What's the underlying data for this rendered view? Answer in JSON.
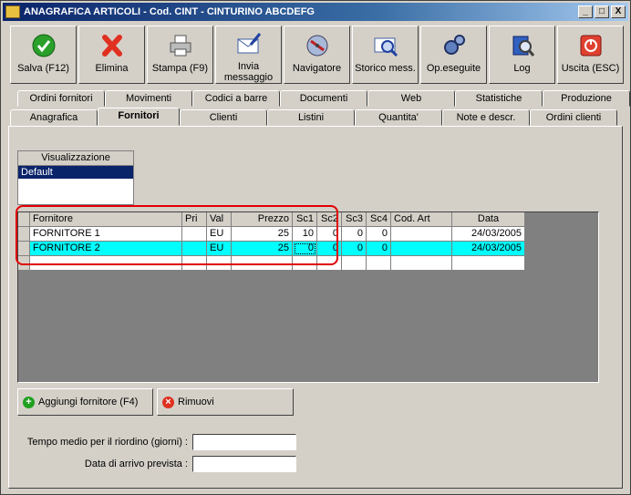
{
  "window": {
    "title": "ANAGRAFICA ARTICOLI - Cod. CINT - CINTURINO ABCDEFG",
    "min": "_",
    "max": "□",
    "close": "X"
  },
  "toolbar": [
    {
      "label": "Salva (F12)",
      "icon": "check-icon"
    },
    {
      "label": "Elimina",
      "icon": "delete-x-icon"
    },
    {
      "label": "Stampa (F9)",
      "icon": "printer-icon"
    },
    {
      "label": "Invia messaggio",
      "icon": "envelope-pen-icon"
    },
    {
      "label": "Navigatore",
      "icon": "compass-icon"
    },
    {
      "label": "Storico mess.",
      "icon": "envelope-search-icon"
    },
    {
      "label": "Op.eseguite",
      "icon": "gears-icon"
    },
    {
      "label": "Log",
      "icon": "book-search-icon"
    },
    {
      "label": "Uscita (ESC)",
      "icon": "power-icon"
    }
  ],
  "tabs_back": [
    "Ordini fornitori",
    "Movimenti",
    "Codici a barre",
    "Documenti",
    "Web",
    "Statistiche",
    "Produzione"
  ],
  "tabs_front": [
    "Anagrafica",
    "Fornitori",
    "Clienti",
    "Listini",
    "Quantita'",
    "Note e descr.",
    "Ordini clienti"
  ],
  "visualizzazione": {
    "header": "Visualizzazione",
    "selected": "Default"
  },
  "grid": {
    "headers": [
      "",
      "Fornitore",
      "Pri",
      "Val",
      "Prezzo",
      "Sc1",
      "Sc2",
      "Sc3",
      "Sc4",
      "Cod. Art",
      "Data"
    ],
    "rows": [
      {
        "cells": [
          "",
          "FORNITORE 1",
          "",
          "EU",
          "25",
          "10",
          "0",
          "0",
          "0",
          "",
          "24/03/2005"
        ],
        "selected": false
      },
      {
        "cells": [
          "",
          "FORNITORE 2",
          "",
          "EU",
          "25",
          "0",
          "0",
          "0",
          "0",
          "",
          "24/03/2005"
        ],
        "selected": true
      }
    ]
  },
  "buttons": {
    "add": "Aggiungi fornitore (F4)",
    "remove": "Rimuovi"
  },
  "fields": {
    "tempo_label": "Tempo medio per il riordino (giorni) :",
    "tempo_value": "",
    "data_label": "Data di arrivo prevista :",
    "data_value": ""
  },
  "colors": {
    "selected_row": "#00ffff",
    "annotation": "#e00000"
  }
}
